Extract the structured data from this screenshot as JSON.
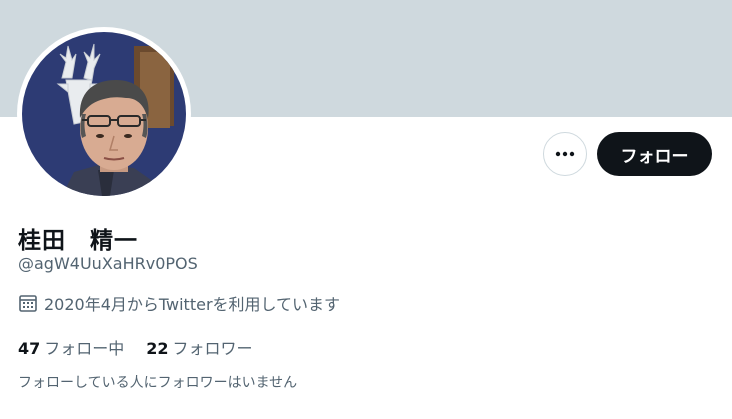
{
  "profile": {
    "display_name": "桂田　精一",
    "handle": "@agW4UuXaHRv0POS",
    "joined": "2020年4月からTwitterを利用しています",
    "following_count": "47",
    "following_label": "フォロー中",
    "followers_count": "22",
    "followers_label": "フォロワー",
    "followers_note": "フォローしている人にフォロワーはいません"
  },
  "actions": {
    "follow_label": "フォロー"
  },
  "icons": {
    "more": "more-horizontal-icon",
    "calendar": "calendar-icon"
  },
  "colors": {
    "banner": "#cfd9de",
    "primary_text": "#0f1419",
    "secondary_text": "#536471",
    "button_bg": "#0f1419",
    "avatar_wall": "#2c3a73"
  }
}
